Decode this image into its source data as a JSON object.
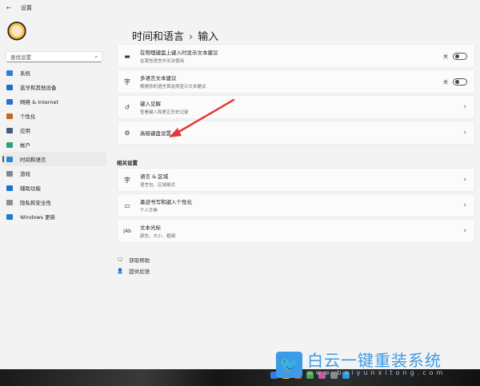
{
  "window": {
    "title": "设置",
    "back_icon": "back-arrow-icon"
  },
  "sidebar": {
    "search_placeholder": "查找设置",
    "items": [
      {
        "label": "系统",
        "color": "#2f7fd6"
      },
      {
        "label": "蓝牙和其他设备",
        "color": "#1f6fd0"
      },
      {
        "label": "网络 & Internet",
        "color": "#2a6fd8"
      },
      {
        "label": "个性化",
        "color": "#c06a2a"
      },
      {
        "label": "应用",
        "color": "#4a5a7a"
      },
      {
        "label": "帐户",
        "color": "#2aa37a"
      },
      {
        "label": "时间和语言",
        "color": "#2a8ad8"
      },
      {
        "label": "游戏",
        "color": "#7a8a9a"
      },
      {
        "label": "辅助功能",
        "color": "#1f6fd0"
      },
      {
        "label": "隐私和安全性",
        "color": "#8a8f98"
      },
      {
        "label": "Windows 更新",
        "color": "#1f78d8"
      }
    ],
    "selected_index": 6
  },
  "breadcrumb": {
    "parent": "时间和语言",
    "separator": "›",
    "current": "输入"
  },
  "settings": [
    {
      "title": "在物理键盘上键入时显示文本建议",
      "subtitle": "在某些语言中无法使用",
      "toggle_label": "关",
      "toggle_on": false,
      "icon": "keyboard-icon"
    },
    {
      "title": "多语言文本建议",
      "subtitle": "根据你的语言首选项显示文本建议",
      "toggle_label": "关",
      "toggle_on": false,
      "icon": "language-icon"
    },
    {
      "title": "键入见解",
      "subtitle": "查看键入和更正历史记录",
      "icon": "history-icon"
    },
    {
      "title": "高级键盘设置",
      "icon": "gear-icon"
    }
  ],
  "related": {
    "heading": "相关设置",
    "items": [
      {
        "title": "语言 & 区域",
        "subtitle": "语言包、区域格式"
      },
      {
        "title": "墨迹书写和键入个性化",
        "subtitle": "个人字典"
      },
      {
        "title": "文本光标",
        "subtitle": "颜色、大小、粗细"
      }
    ]
  },
  "links": {
    "help": "获取帮助",
    "feedback": "提供反馈"
  },
  "watermark": {
    "cn": "白云一键重装系统",
    "en": "www.baiyunxitong.com"
  },
  "accent": "#e53935"
}
